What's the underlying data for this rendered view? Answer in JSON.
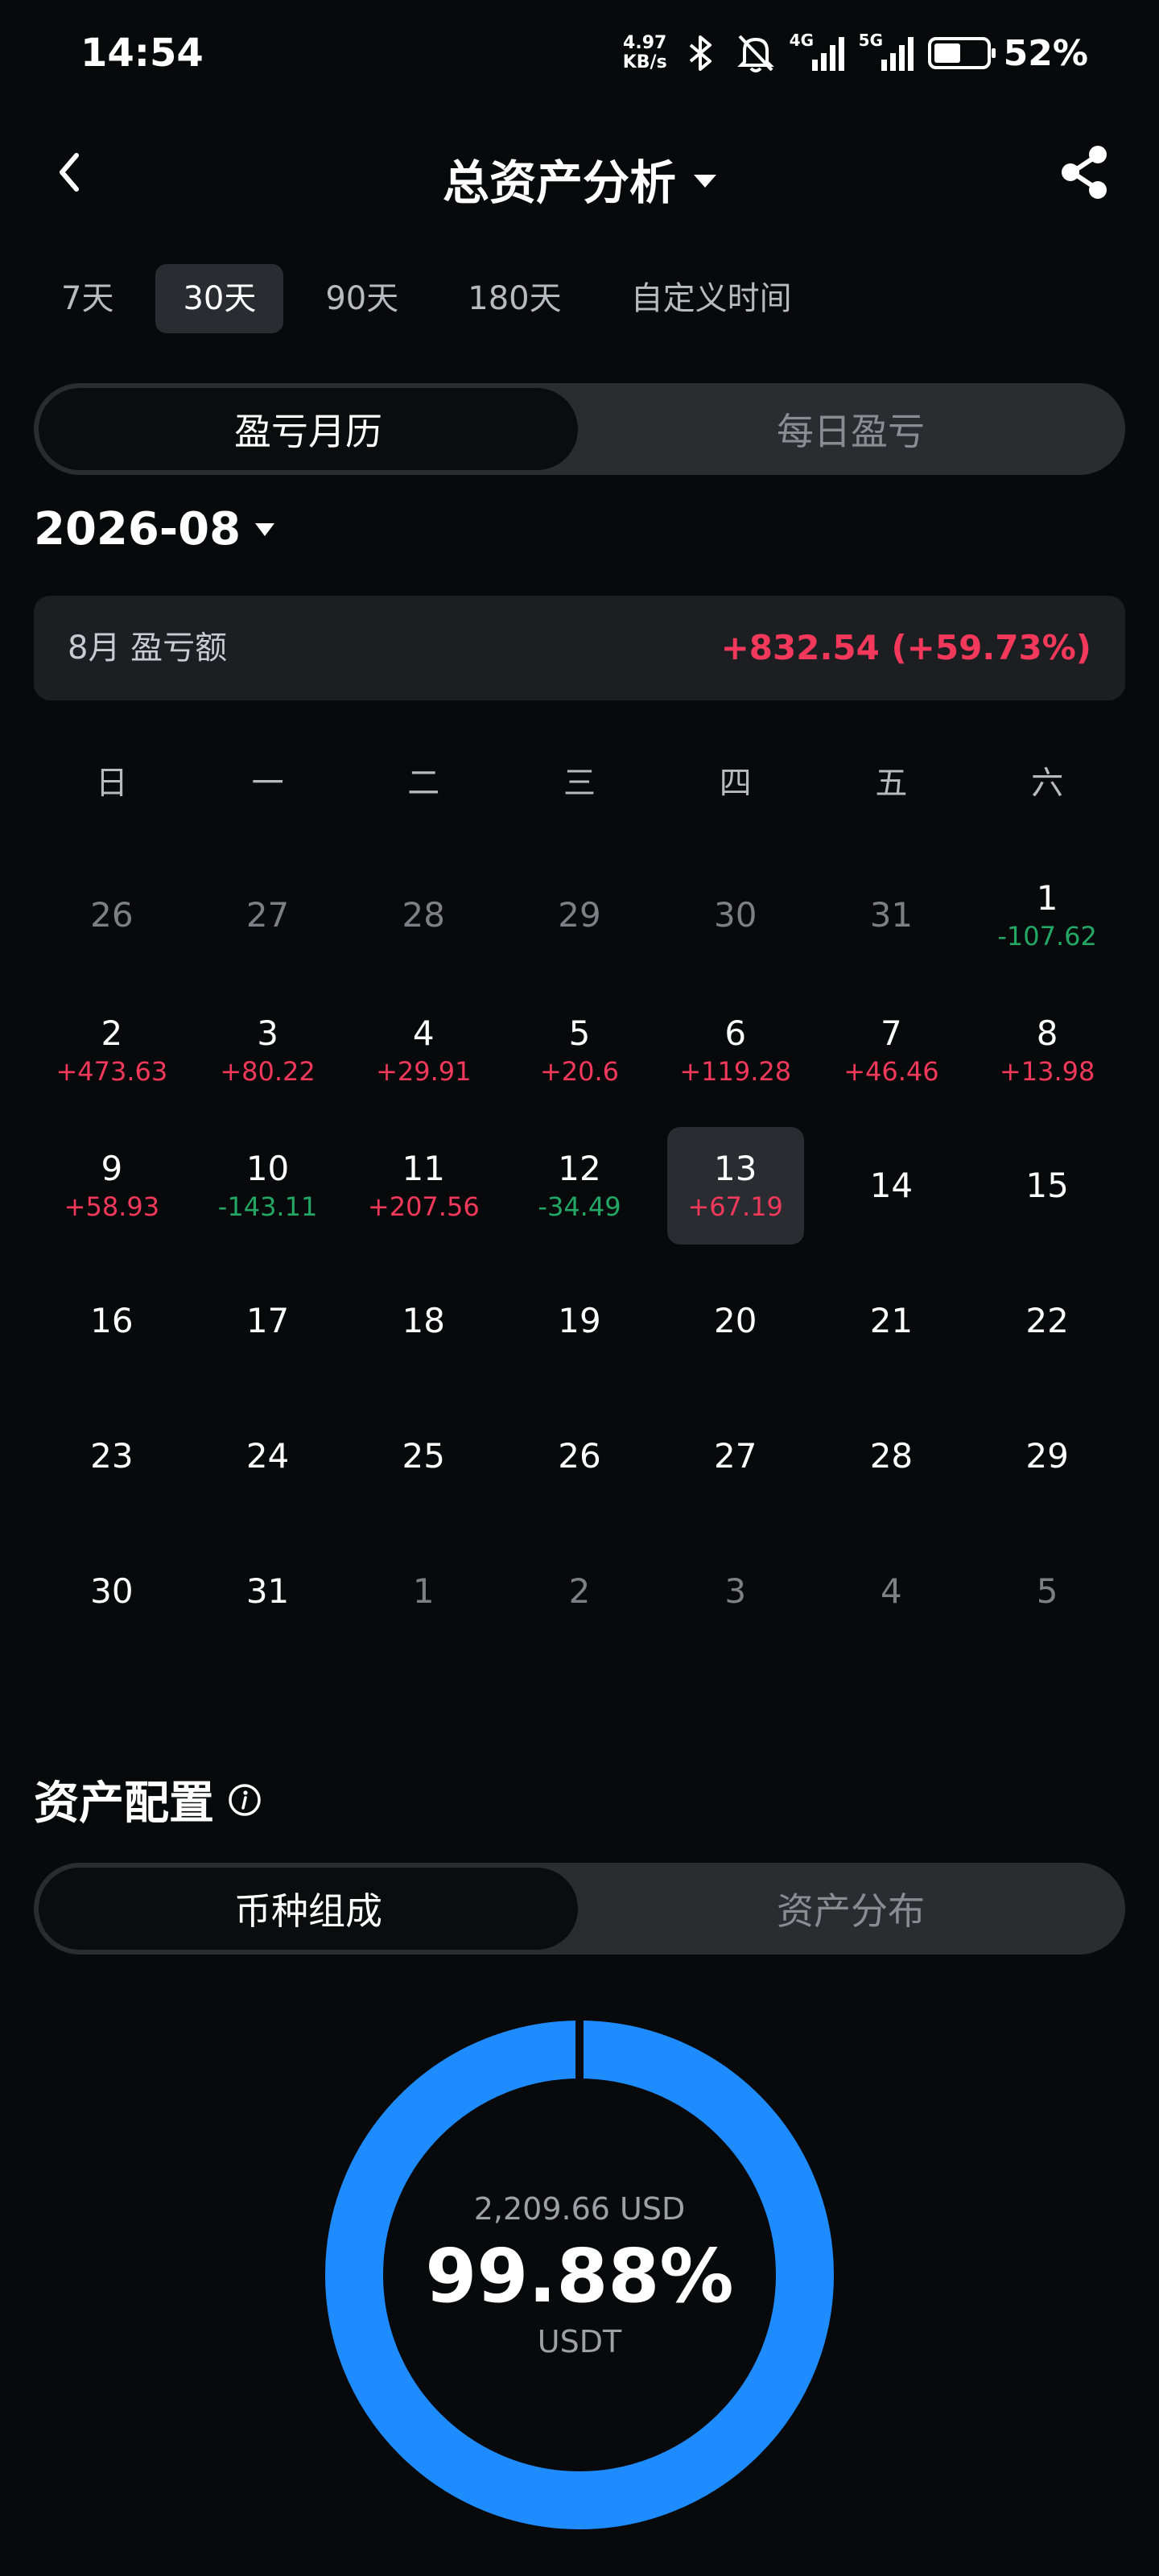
{
  "status_bar": {
    "time": "14:54",
    "net_speed_value": "4.97",
    "net_speed_unit": "KB/s",
    "signal1_label": "4G",
    "signal2_label": "5G",
    "battery_pct": "52%",
    "battery_level": 0.52
  },
  "header": {
    "title": "总资产分析"
  },
  "range_tabs": [
    "7天",
    "30天",
    "90天",
    "180天",
    "自定义时间"
  ],
  "range_active_index": 1,
  "pnl_switch": {
    "left": "盈亏月历",
    "right": "每日盈亏"
  },
  "month": "2026-08",
  "summary": {
    "label": "8月 盈亏额",
    "value": "+832.54 (+59.73%)"
  },
  "weekdays": [
    "日",
    "一",
    "二",
    "三",
    "四",
    "五",
    "六"
  ],
  "calendar": [
    {
      "day": "26",
      "muted": true
    },
    {
      "day": "27",
      "muted": true
    },
    {
      "day": "28",
      "muted": true
    },
    {
      "day": "29",
      "muted": true
    },
    {
      "day": "30",
      "muted": true
    },
    {
      "day": "31",
      "muted": true
    },
    {
      "day": "1",
      "pnl": "-107.62"
    },
    {
      "day": "2",
      "pnl": "+473.63"
    },
    {
      "day": "3",
      "pnl": "+80.22"
    },
    {
      "day": "4",
      "pnl": "+29.91"
    },
    {
      "day": "5",
      "pnl": "+20.6"
    },
    {
      "day": "6",
      "pnl": "+119.28"
    },
    {
      "day": "7",
      "pnl": "+46.46"
    },
    {
      "day": "8",
      "pnl": "+13.98"
    },
    {
      "day": "9",
      "pnl": "+58.93"
    },
    {
      "day": "10",
      "pnl": "-143.11"
    },
    {
      "day": "11",
      "pnl": "+207.56"
    },
    {
      "day": "12",
      "pnl": "-34.49"
    },
    {
      "day": "13",
      "pnl": "+67.19",
      "selected": true
    },
    {
      "day": "14"
    },
    {
      "day": "15"
    },
    {
      "day": "16"
    },
    {
      "day": "17"
    },
    {
      "day": "18"
    },
    {
      "day": "19"
    },
    {
      "day": "20"
    },
    {
      "day": "21"
    },
    {
      "day": "22"
    },
    {
      "day": "23"
    },
    {
      "day": "24"
    },
    {
      "day": "25"
    },
    {
      "day": "26"
    },
    {
      "day": "27"
    },
    {
      "day": "28"
    },
    {
      "day": "29"
    },
    {
      "day": "30"
    },
    {
      "day": "31"
    },
    {
      "day": "1",
      "muted": true
    },
    {
      "day": "2",
      "muted": true
    },
    {
      "day": "3",
      "muted": true
    },
    {
      "day": "4",
      "muted": true
    },
    {
      "day": "5",
      "muted": true
    }
  ],
  "asset_section": {
    "title": "资产配置"
  },
  "asset_switch": {
    "left": "币种组成",
    "right": "资产分布"
  },
  "donut": {
    "amount": "2,209.66 USD",
    "percent": "99.88%",
    "name": "USDT",
    "main_share": 0.9988,
    "main_color": "#1e8bff",
    "rest_color": "#08090b"
  },
  "colors": {
    "up": "#f2395b",
    "down": "#22a864",
    "background": "#08090b"
  }
}
